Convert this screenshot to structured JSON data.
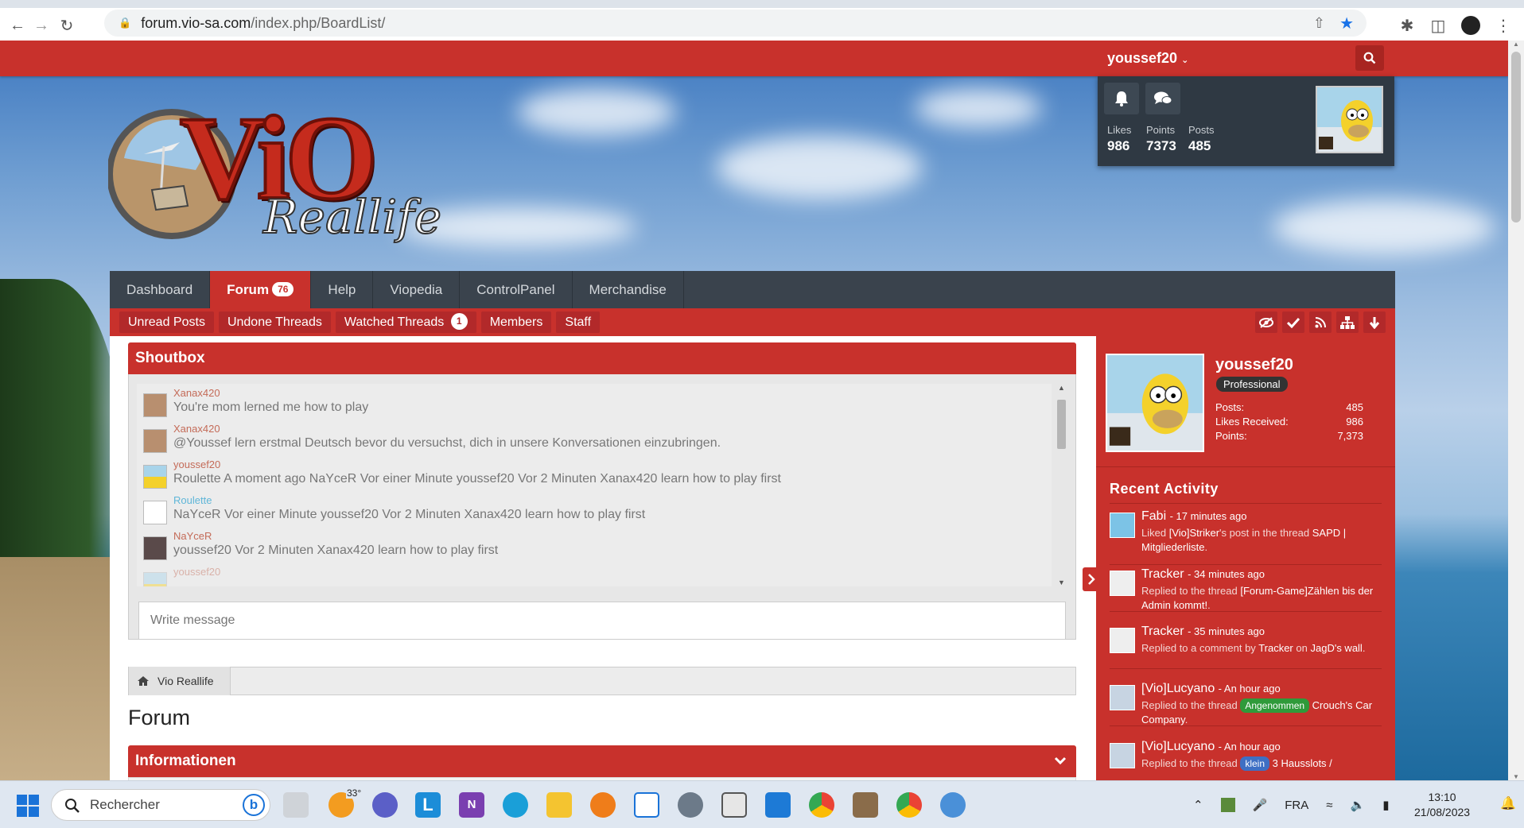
{
  "browser": {
    "url_domain": "forum.vio-sa.com",
    "url_path": "/index.php/BoardList/"
  },
  "header": {
    "username": "youssef20",
    "stats": [
      {
        "label": "Likes",
        "value": "986"
      },
      {
        "label": "Points",
        "value": "7373"
      },
      {
        "label": "Posts",
        "value": "485"
      }
    ]
  },
  "logo": {
    "text_main": "ViO",
    "text_sub": "Reallife"
  },
  "nav": {
    "tabs": [
      {
        "label": "Dashboard",
        "badge": ""
      },
      {
        "label": "Forum",
        "badge": "76"
      },
      {
        "label": "Help",
        "badge": ""
      },
      {
        "label": "Viopedia",
        "badge": ""
      },
      {
        "label": "ControlPanel",
        "badge": ""
      },
      {
        "label": "Merchandise",
        "badge": ""
      }
    ],
    "subtabs": [
      {
        "label": "Unread Posts",
        "badge": ""
      },
      {
        "label": "Undone Threads",
        "badge": ""
      },
      {
        "label": "Watched Threads",
        "badge": "1"
      },
      {
        "label": "Members",
        "badge": ""
      },
      {
        "label": "Staff",
        "badge": ""
      }
    ]
  },
  "shoutbox": {
    "title": "Shoutbox",
    "messages": [
      {
        "author": "Xanax420",
        "text": "You're mom lerned me how to play"
      },
      {
        "author": "Xanax420",
        "text": "@Youssef lern erstmal Deutsch bevor du versuchst, dich in unsere Konversationen einzubringen."
      },
      {
        "author": "youssef20",
        "text": "Roulette A moment ago NaYceR Vor einer Minute youssef20 Vor 2 Minuten Xanax420 learn how to play first"
      },
      {
        "author": "Roulette",
        "text": "NaYceR Vor einer Minute youssef20 Vor 2 Minuten Xanax420 learn how to play first"
      },
      {
        "author": "NaYceR",
        "text": "youssef20 Vor 2 Minuten Xanax420 learn how to play first"
      },
      {
        "author": "youssef20",
        "text": ""
      }
    ],
    "input_placeholder": "Write message"
  },
  "breadcrumb": {
    "label": "Vio Reallife"
  },
  "page_title": "Forum",
  "section_informationen": "Informationen",
  "sidebar": {
    "profile": {
      "name": "youssef20",
      "rank": "Professional",
      "stats": [
        {
          "label": "Posts:",
          "value": "485"
        },
        {
          "label": "Likes Received:",
          "value": "986"
        },
        {
          "label": "Points:",
          "value": "7,373"
        }
      ]
    },
    "recent_title": "Recent Activity",
    "recent": [
      {
        "user": "Fabi",
        "time": "17 minutes ago",
        "pre": "Liked",
        "b1": "[Vio]Striker",
        "mid": "'s post in the thread",
        "b2": "SAPD | Mitgliederliste",
        "post": ".",
        "tag": "",
        "tagcolor": ""
      },
      {
        "user": "Tracker",
        "time": "34 minutes ago",
        "pre": "Replied to the thread",
        "b1": "[Forum-Game]Zählen bis der Admin kommt!",
        "mid": ".",
        "b2": "",
        "post": "",
        "tag": "",
        "tagcolor": ""
      },
      {
        "user": "Tracker",
        "time": "35 minutes ago",
        "pre": "Replied to a comment by",
        "b1": "Tracker",
        "mid": "on",
        "b2": "JagD's wall",
        "post": ".",
        "tag": "",
        "tagcolor": ""
      },
      {
        "user": "[Vio]Lucyano",
        "time": "An hour ago",
        "pre": "Replied to the thread",
        "b1": "",
        "mid": "",
        "b2": "Crouch's Car Company",
        "post": ".",
        "tag": "Angenommen",
        "tagcolor": "#2f9a3a"
      },
      {
        "user": "[Vio]Lucyano",
        "time": "An hour ago",
        "pre": "Replied to the thread",
        "b1": "",
        "mid": "",
        "b2": "3 Hausslots /",
        "post": "",
        "tag": "klein",
        "tagcolor": "#3e6fc4"
      }
    ]
  },
  "taskbar": {
    "search_placeholder": "Rechercher",
    "weather": "33°",
    "language": "FRA",
    "time": "13:10",
    "date": "21/08/2023"
  }
}
